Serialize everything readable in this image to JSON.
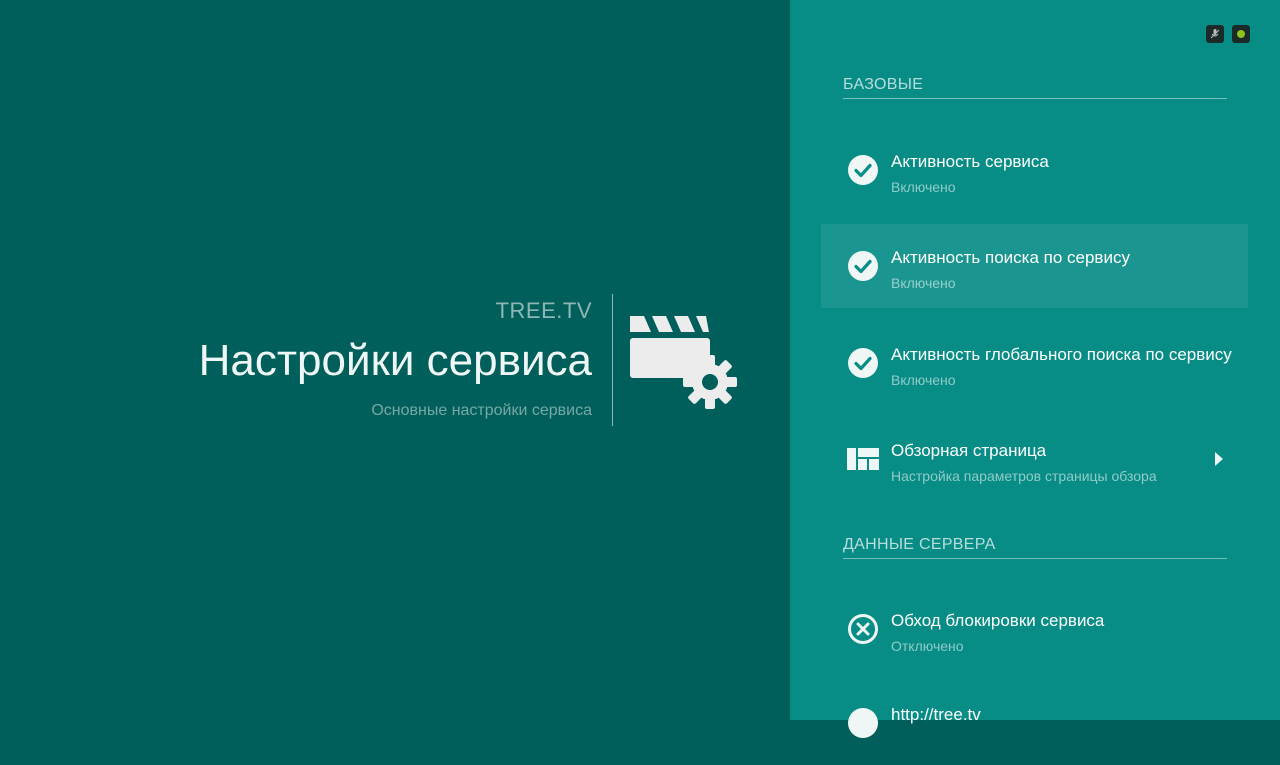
{
  "hero": {
    "app_name": "TREE.TV",
    "title": "Настройки сервиса",
    "subtitle": "Основные настройки сервиса",
    "icon": "clapperboard-gear-icon"
  },
  "status_bar": {
    "icons": [
      "mic-off-icon",
      "network-indicator-icon"
    ]
  },
  "sections": [
    {
      "header": "БАЗОВЫЕ",
      "items": [
        {
          "title": "Активность сервиса",
          "status": "Включено",
          "icon": "check-circle-icon"
        },
        {
          "title": "Активность поиска по сервису",
          "status": "Включено",
          "icon": "check-circle-icon",
          "selected": true
        },
        {
          "title": "Активность глобального поиска по сервису",
          "status": "Включено",
          "icon": "check-circle-icon"
        },
        {
          "title": "Обзорная страница",
          "status": "Настройка параметров страницы обзора",
          "icon": "dashboard-layout-icon",
          "has_submenu": true
        }
      ]
    },
    {
      "header": "ДАННЫЕ СЕРВЕРА",
      "items": [
        {
          "title": "Обход блокировки сервиса",
          "status": "Отключено",
          "icon": "x-circle-icon"
        },
        {
          "title": "http://tree.tv",
          "status": "",
          "icon": "circle-icon"
        }
      ]
    }
  ],
  "colors": {
    "background_left": "#015f5b",
    "panel": "#078c86",
    "selected_row": "rgba(255,255,255,0.08)"
  }
}
